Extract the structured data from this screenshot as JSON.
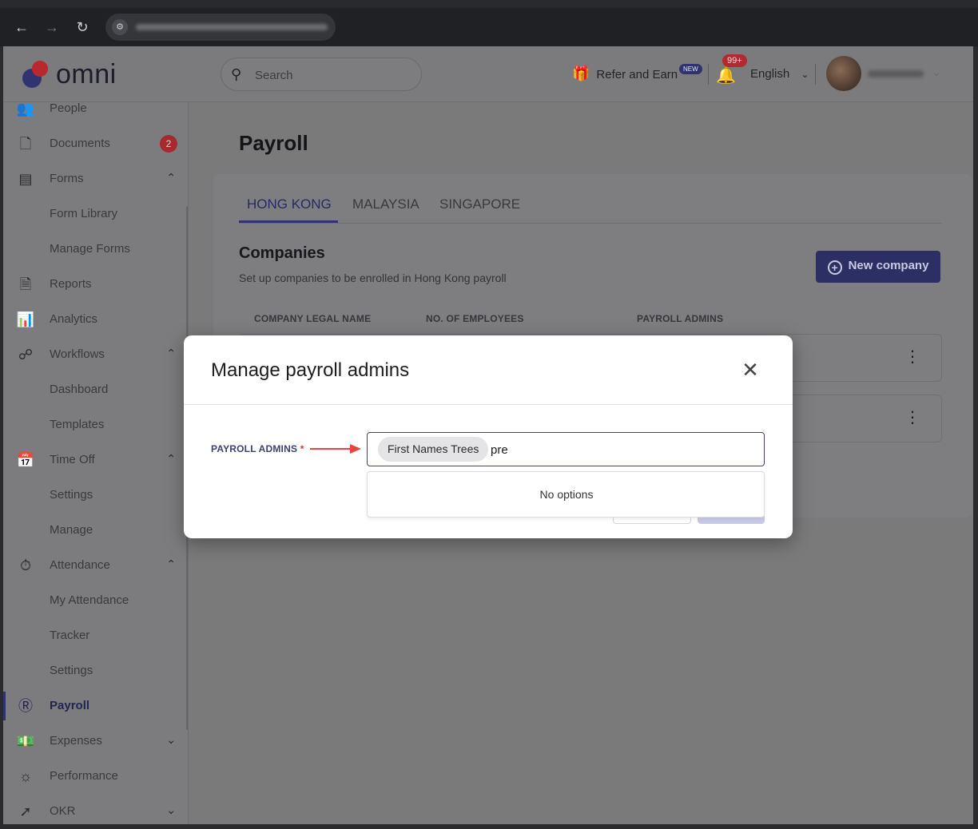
{
  "browser": {
    "back_icon": "arrow-left-icon",
    "forward_icon": "arrow-right-icon",
    "reload_icon": "reload-icon"
  },
  "topbar": {
    "logo_text": "omni",
    "search_placeholder": "Search",
    "refer_label": "Refer and Earn",
    "new_badge": "NEW",
    "notifications_count": "99+",
    "language": "English"
  },
  "sidebar": {
    "items": [
      {
        "label": "People",
        "icon": "people-icon"
      },
      {
        "label": "Documents",
        "icon": "documents-icon",
        "badge": "2"
      },
      {
        "label": "Forms",
        "icon": "forms-icon"
      },
      {
        "label": "Form Library"
      },
      {
        "label": "Manage Forms"
      },
      {
        "label": "Reports",
        "icon": "reports-icon"
      },
      {
        "label": "Analytics",
        "icon": "analytics-icon"
      },
      {
        "label": "Workflows",
        "icon": "workflows-icon"
      },
      {
        "label": "Dashboard"
      },
      {
        "label": "Templates"
      },
      {
        "label": "Time Off",
        "icon": "time-off-icon"
      },
      {
        "label": "Settings"
      },
      {
        "label": "Manage"
      },
      {
        "label": "Attendance",
        "icon": "attendance-icon"
      },
      {
        "label": "My Attendance"
      },
      {
        "label": "Tracker"
      },
      {
        "label": "Settings"
      },
      {
        "label": "Payroll",
        "icon": "payroll-icon"
      },
      {
        "label": "Expenses",
        "icon": "expenses-icon"
      },
      {
        "label": "Performance",
        "icon": "performance-icon"
      },
      {
        "label": "OKR",
        "icon": "okr-icon"
      }
    ]
  },
  "main": {
    "page_title": "Payroll",
    "tabs": [
      {
        "label": "HONG KONG"
      },
      {
        "label": "MALAYSIA"
      },
      {
        "label": "SINGAPORE"
      }
    ],
    "companies_title": "Companies",
    "companies_subtitle": "Set up companies to be enrolled in Hong Kong payroll",
    "new_company_label": "New company",
    "table_headers": [
      "COMPANY LEGAL NAME",
      "NO. OF EMPLOYEES",
      "PAYROLL ADMINS"
    ]
  },
  "modal": {
    "title": "Manage payroll admins",
    "field_label": "PAYROLL ADMINS",
    "required_mark": "*",
    "selected_chip": "First Names Trees",
    "input_value": "pre",
    "no_options": "No options"
  },
  "colors": {
    "accent": "#2f3370",
    "arrow": "#e5483a",
    "badge": "#b02a2f"
  }
}
